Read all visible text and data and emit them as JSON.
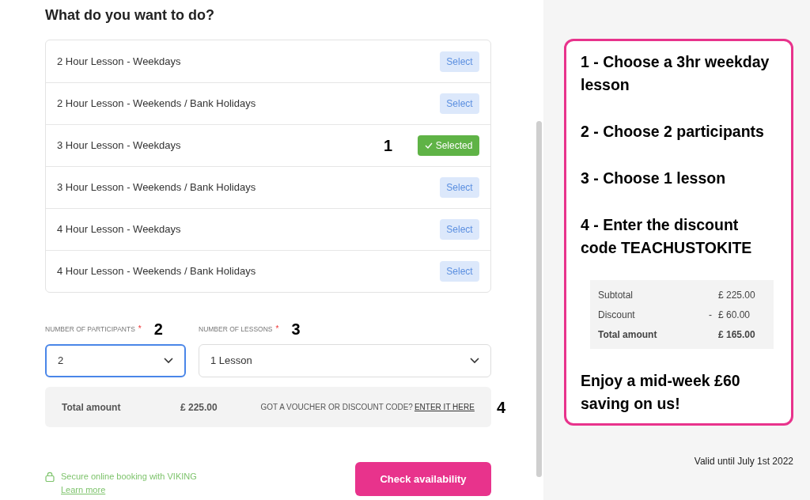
{
  "heading": "What do you want to do?",
  "lessons": [
    {
      "label": "2 Hour Lesson - Weekdays",
      "button": "Select",
      "selected": false
    },
    {
      "label": "2 Hour Lesson - Weekends / Bank Holidays",
      "button": "Select",
      "selected": false
    },
    {
      "label": "3 Hour Lesson - Weekdays",
      "button": "Selected",
      "selected": true,
      "annotation": "1"
    },
    {
      "label": "3 Hour Lesson - Weekends / Bank Holidays",
      "button": "Select",
      "selected": false
    },
    {
      "label": "4 Hour Lesson - Weekdays",
      "button": "Select",
      "selected": false
    },
    {
      "label": "4 Hour Lesson - Weekends / Bank Holidays",
      "button": "Select",
      "selected": false
    }
  ],
  "fields": [
    {
      "label": "NUMBER OF PARTICIPANTS",
      "required": "*",
      "annotation": "2",
      "value": "2",
      "focused": true
    },
    {
      "label": "NUMBER OF LESSONS",
      "required": "*",
      "annotation": "3",
      "value": "1 Lesson",
      "focused": false
    }
  ],
  "total": {
    "label": "Total amount",
    "amount": "£ 225.00",
    "voucher_prompt": "GOT A VOUCHER OR DISCOUNT CODE?",
    "voucher_link": "ENTER IT HERE",
    "annotation": "4"
  },
  "secure": {
    "text": "Secure online booking with VIKING",
    "link": "Learn more"
  },
  "check_button": "Check availability",
  "instructions": {
    "steps": [
      "1 - Choose a 3hr weekday lesson",
      "2 - Choose 2 participants",
      "3 - Choose 1 lesson",
      "4 - Enter the discount code TEACHUSTOKITE"
    ],
    "summary": [
      {
        "label": "Subtotal",
        "value": "£ 225.00"
      },
      {
        "label": "Discount",
        "sign": "-",
        "value": "£ 60.00"
      },
      {
        "label": "Total amount",
        "value": "£ 165.00"
      }
    ],
    "closing": "Enjoy a mid-week £60 saving on us!"
  },
  "validity": "Valid until July 1st 2022"
}
